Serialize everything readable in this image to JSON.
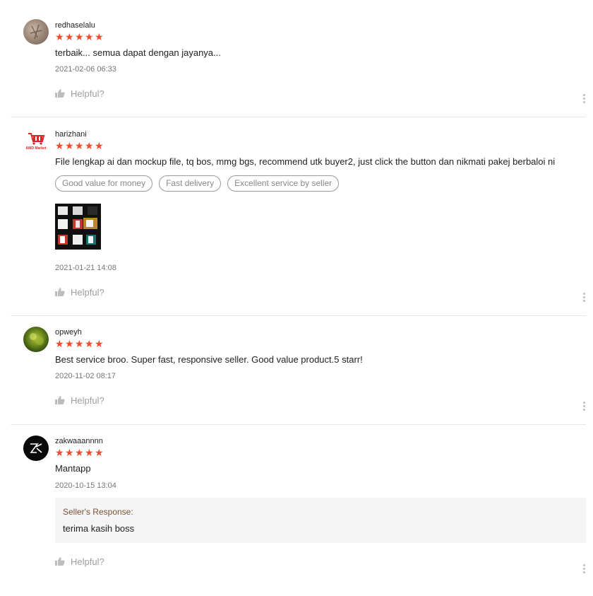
{
  "reviews": [
    {
      "username": "redhaselalu",
      "rating": 5,
      "comment": "terbaik... semua dapat dengan jayanya...",
      "date": "2021-02-06 06:33",
      "helpful_label": "Helpful?"
    },
    {
      "username": "harizhani",
      "avatar_text": "AMD Market",
      "rating": 5,
      "comment": "File lengkap ai dan mockup file, tq bos, mmg bgs, recommend utk buyer2, just click the button dan nikmati pakej berbaloi ni",
      "tags": [
        "Good value for money",
        "Fast delivery",
        "Excellent service by seller"
      ],
      "date": "2021-01-21 14:08",
      "helpful_label": "Helpful?"
    },
    {
      "username": "opweyh",
      "rating": 5,
      "comment": "Best service broo. Super fast, responsive seller. Good value product.5 starr!",
      "date": "2020-11-02 08:17",
      "helpful_label": "Helpful?"
    },
    {
      "username": "zakwaaannnn",
      "rating": 5,
      "comment": "Mantapp",
      "date": "2020-10-15 13:04",
      "seller_response": {
        "title": "Seller's Response:",
        "text": "terima kasih boss"
      },
      "helpful_label": "Helpful?"
    }
  ],
  "colors": {
    "star": "#ee4d2d",
    "seller_title": "#7b5339"
  },
  "icons": {
    "star": "star-icon",
    "helpful": "thumbs-up-icon",
    "more": "more-vertical-icon"
  }
}
